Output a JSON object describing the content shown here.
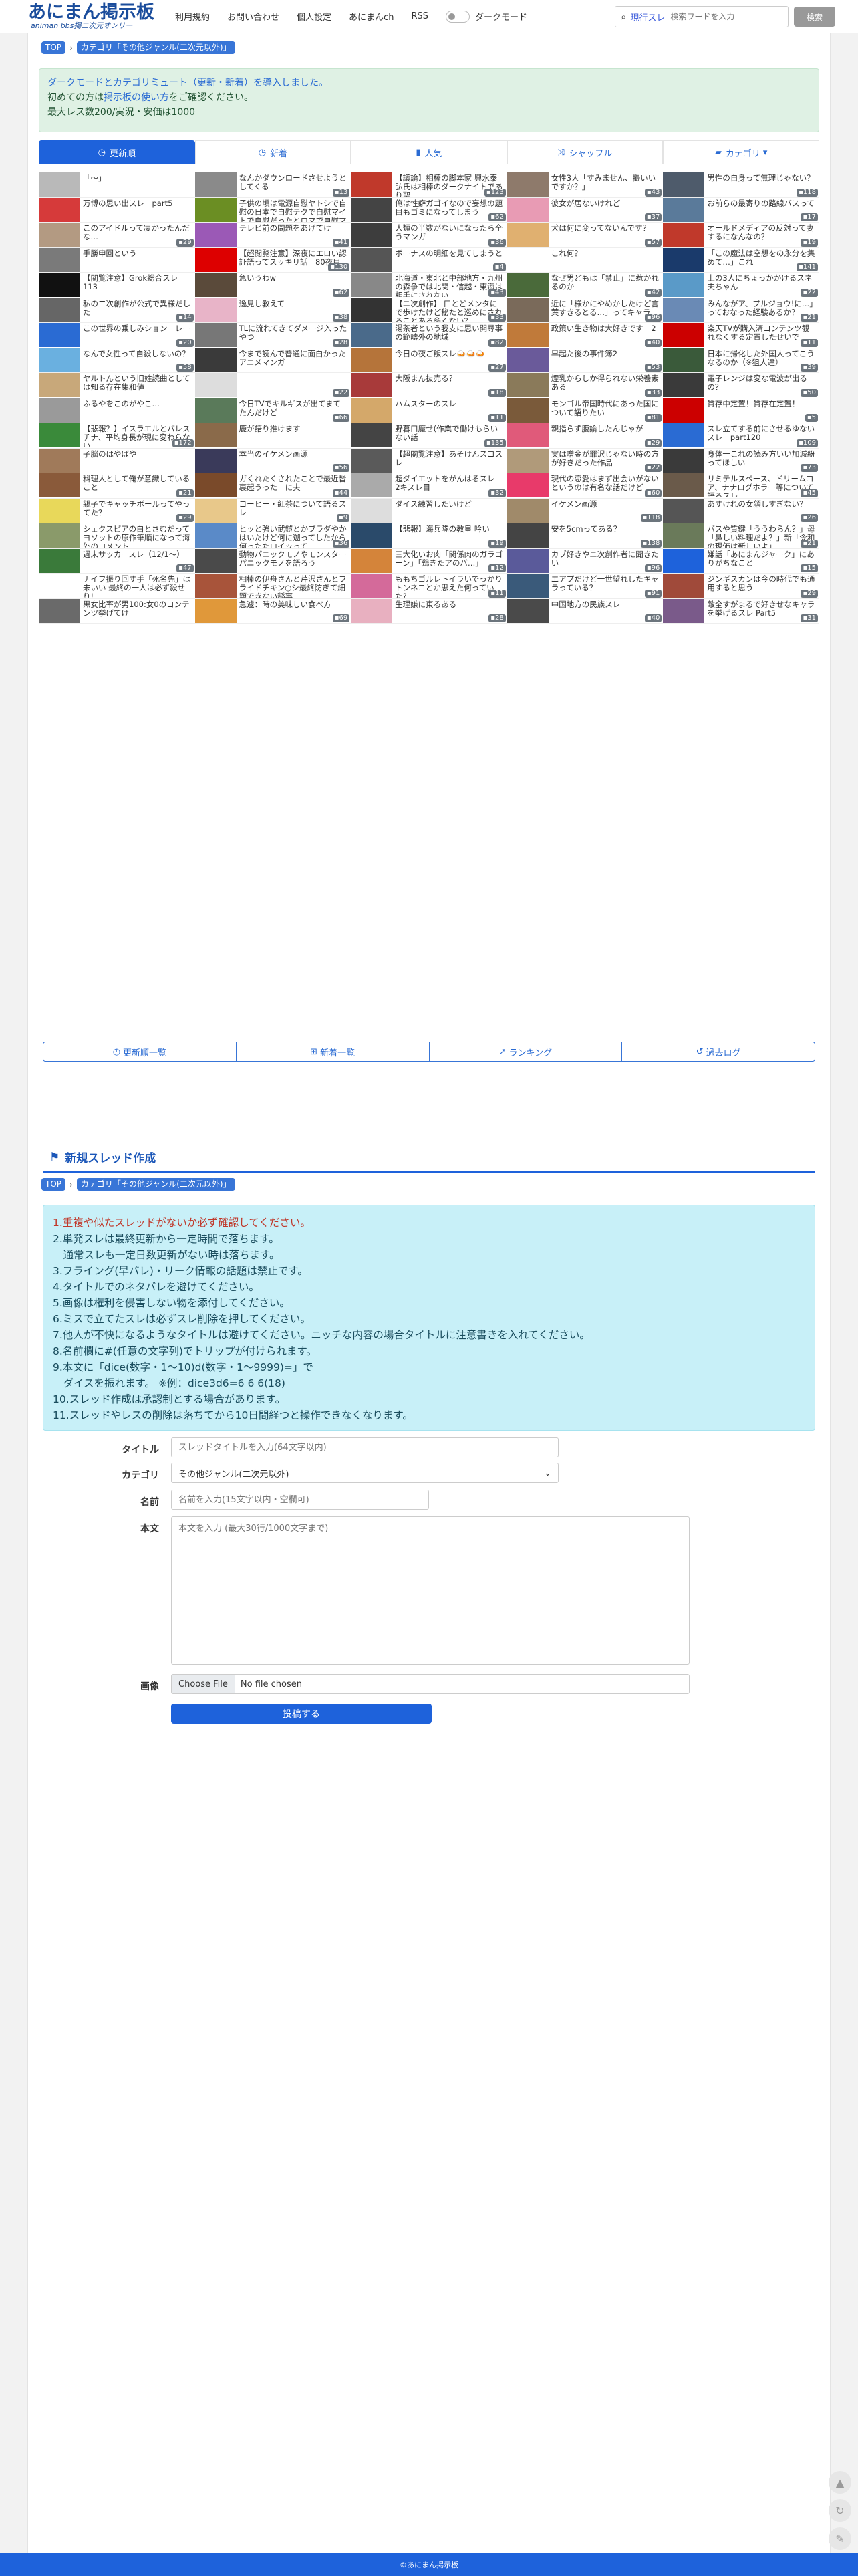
{
  "header": {
    "logo_main": "あにまん掲示板",
    "logo_sub": "animan bbs掲二次元オンリー",
    "nav": [
      "利用規約",
      "お問い合わせ",
      "個人設定",
      "あにまんch",
      "RSS"
    ],
    "dark_mode_label": "ダークモード",
    "search_scope": "現行スレ",
    "search_placeholder": "検索ワードを入力",
    "search_button": "検索"
  },
  "breadcrumb": [
    "TOP",
    "カテゴリ「その他ジャンル(二次元以外)」"
  ],
  "notice": {
    "line1": "ダークモードとカテゴリミュート（更新・新着）を導入しました。",
    "line2_pre": "初めての方は",
    "line2_link": "掲示板の使い方",
    "line2_post": "をご確認ください。",
    "line3": "最大レス数200/実況・安価は1000"
  },
  "tabs": [
    {
      "label": "更新順",
      "icon": "clock-icon"
    },
    {
      "label": "新着",
      "icon": "clock-icon"
    },
    {
      "label": "人気",
      "icon": "chart-icon"
    },
    {
      "label": "シャッフル",
      "icon": "shuffle-icon"
    },
    {
      "label": "カテゴリ",
      "icon": "folder-icon"
    }
  ],
  "threads": [
    {
      "title": "「～」",
      "count": "",
      "color": "#b9b9b9"
    },
    {
      "title": "なんかダウンロードさせようとしてくる",
      "count": "13",
      "color": "#8a8a8a"
    },
    {
      "title": "【議論】相棒の脚本家 興水泰弘氏は相棒のダークナイトであり聖…",
      "count": "123",
      "color": "#c0392b"
    },
    {
      "title": "女性3人「すみません、撮いいですか？」",
      "count": "43",
      "color": "#8e7a6b"
    },
    {
      "title": "男性の自身って無理じゃない？",
      "count": "118",
      "color": "#4e5b6b"
    },
    {
      "title": "万博の思い出スレ　part5",
      "count": "",
      "color": "#d63a3a"
    },
    {
      "title": "子供の頃は電源自慰ヤトシで自慰の日本で自慰テクで自慰マイトで自慰だったとロマで自慰マイト…",
      "count": "",
      "color": "#6b8e23"
    },
    {
      "title": "俺は性癖ガゴイなので妄想の題目もゴミになってしまう",
      "count": "62",
      "color": "#444"
    },
    {
      "title": "彼女が居ないけれど",
      "count": "37",
      "color": "#e89bb4"
    },
    {
      "title": "お前らの最寄りの路線バスって",
      "count": "17",
      "color": "#5a7a9a"
    },
    {
      "title": "このアイドルって凄かったんだな…",
      "count": "29",
      "color": "#b39a82"
    },
    {
      "title": "テレビ前の問題をあげてけ",
      "count": "41",
      "color": "#9b59b6"
    },
    {
      "title": "人類の半数がないになったら全うマンガ",
      "count": "36",
      "color": "#3d3d3d"
    },
    {
      "title": "犬は何に変ってないんです？",
      "count": "57",
      "color": "#e0b070"
    },
    {
      "title": "オールドメディアの反対って妻するになんなの？",
      "count": "19",
      "color": "#c0392b"
    },
    {
      "title": "手勝申回という",
      "count": "",
      "color": "#7a7a7a"
    },
    {
      "title": "【超閲覧注意】深夜にエロい認証語ってスッキリ話　80夜目",
      "count": "130",
      "color": "#d00"
    },
    {
      "title": "ボーナスの明細を見てしまうと",
      "count": "4",
      "color": "#555"
    },
    {
      "title": "これ何？",
      "count": "",
      "color": "#fff"
    },
    {
      "title": "「この魔法は空想をの永分を集めて…」これ",
      "count": "141",
      "color": "#1a3a6b"
    },
    {
      "title": "【閲覧注意】Grok総合スレ113",
      "count": "",
      "color": "#111"
    },
    {
      "title": "急いうわw",
      "count": "62",
      "color": "#5a4a3a"
    },
    {
      "title": "北海道・東北と中部地方・九州の森争では北関・信越・東海は相手にされない",
      "count": "43",
      "color": "#888"
    },
    {
      "title": "なぜ男どもは「禁止」に惹かれるのか",
      "count": "42",
      "color": "#4a6a3a"
    },
    {
      "title": "上の3人にちょっかかけるスネ夫ちゃん",
      "count": "22",
      "color": "#5a9ac8"
    },
    {
      "title": "私の二次創作が公式で異様だした",
      "count": "14",
      "color": "#666"
    },
    {
      "title": "逸見し教えて",
      "count": "38",
      "color": "#e8b4c8"
    },
    {
      "title": "【ニ次創作】 口とどメンタにで歩けたけど秘たと巡めにされることある多くない？",
      "count": "33",
      "color": "#333"
    },
    {
      "title": "近に「様かにやめかしたけど言葉すきるとる…」ってキャラ",
      "count": "96",
      "color": "#7a6a5a"
    },
    {
      "title": "みんながア、プルジョウ!に…」っておなった経験あるか？",
      "count": "21",
      "color": "#6a8ab5"
    },
    {
      "title": "この世界の乗しみションーレー",
      "count": "20",
      "color": "#2a6bd3"
    },
    {
      "title": "TLに流れてきてダメージ入ったやつ",
      "count": "28",
      "color": "#777"
    },
    {
      "title": "湯茶者という我支に思い開尋事の範疇外の地域",
      "count": "82",
      "color": "#4a6a8a"
    },
    {
      "title": "政策い生き物は大好きです　2",
      "count": "40",
      "color": "#c07a3a"
    },
    {
      "title": "楽天TVが購入済コンテンツ観れなくする定置したせいで",
      "count": "11",
      "color": "#c00"
    },
    {
      "title": "なんで女性って自殺しないの？",
      "count": "58",
      "color": "#6ab0e0"
    },
    {
      "title": "今まで読んで普通に面白かったアニメマンガ",
      "count": "",
      "color": "#3a3a3a"
    },
    {
      "title": "今日の夜ご飯スレ🍛🍛🍛",
      "count": "27",
      "color": "#b5743a"
    },
    {
      "title": "早起た後の事件簿2",
      "count": "53",
      "color": "#6a5a9a"
    },
    {
      "title": "日本に帰化した外国人ってこうなるのか（※狙人達）",
      "count": "39",
      "color": "#3a5a3a"
    },
    {
      "title": "ヤルトんという旧姓読曲としては知る存在集和値",
      "count": "",
      "color": "#c8a87a"
    },
    {
      "title": "",
      "count": "22",
      "color": "#ddd"
    },
    {
      "title": "大阪まん抜売る？",
      "count": "18",
      "color": "#a83a3a"
    },
    {
      "title": "煙乳からしか得られない栄養素ある",
      "count": "33",
      "color": "#8a7a5a"
    },
    {
      "title": "電子レンジは変な電波が出るの？",
      "count": "50",
      "color": "#3a3a3a"
    },
    {
      "title": "ふるやをこのがやこ…",
      "count": "",
      "color": "#9a9a9a"
    },
    {
      "title": "今日TVでキルギスが出てまてたんだけど",
      "count": "66",
      "color": "#5a7a5a"
    },
    {
      "title": "ハムスターのスレ",
      "count": "11",
      "color": "#d4a86a"
    },
    {
      "title": "モンゴル帝国時代にあった国について語りたい",
      "count": "81",
      "color": "#7a5a3a"
    },
    {
      "title": "質存中定置！質存在定置！",
      "count": "5",
      "color": "#c00"
    },
    {
      "title": "【悲報？】イスラエルとパレスチナ、平均身長が現に変わらない",
      "count": "172",
      "color": "#3a8a3a"
    },
    {
      "title": "鹿が語り推けます",
      "count": "",
      "color": "#8a6a4a"
    },
    {
      "title": "野暮口魔せ(作業で働けもらいない話",
      "count": "135",
      "color": "#444"
    },
    {
      "title": "親指らず腹論したんじゃが",
      "count": "29",
      "color": "#e05a7a"
    },
    {
      "title": "スレ立てする前にさせるゆないスレ　part120",
      "count": "109",
      "color": "#2a6bd3"
    },
    {
      "title": "子脳のはやばや",
      "count": "",
      "color": "#a07a5a"
    },
    {
      "title": "本当のイケメン画源",
      "count": "56",
      "color": "#3a3a5a"
    },
    {
      "title": "【超閲覧注意】あそけんスコスレ",
      "count": "",
      "color": "#5a5a5a"
    },
    {
      "title": "実は噌金が罪沢じゃない時の方が好きだった作品",
      "count": "22",
      "color": "#b09a7a"
    },
    {
      "title": "身体一これの読み方いい加減紛ってほしい",
      "count": "73",
      "color": "#3a3a3a"
    },
    {
      "title": "料理人として俺が意識していること",
      "count": "21",
      "color": "#8a5a3a"
    },
    {
      "title": "ガくれたくされたことで最近皆裏起うった一に夫",
      "count": "44",
      "color": "#7a4a2a"
    },
    {
      "title": "超ダイエットをがんはるスレ　2キスレ目",
      "count": "32",
      "color": "#aaa"
    },
    {
      "title": "現代の恋愛はまず出会いがないというのは有名な話だけど",
      "count": "60",
      "color": "#e83a6a"
    },
    {
      "title": "リミテルスペース、ドリームコア、ナナログホラー等について語るスレ",
      "count": "45",
      "color": "#6a5a4a"
    },
    {
      "title": "親子でキャッチボールってやってた？",
      "count": "29",
      "color": "#e8d85a"
    },
    {
      "title": "コーヒー・紅茶について語るスレ",
      "count": "9",
      "color": "#e8c88a"
    },
    {
      "title": "ダイス練習したいけど",
      "count": "",
      "color": "#ddd"
    },
    {
      "title": "イケメン画源",
      "count": "118",
      "color": "#a08a6a"
    },
    {
      "title": "あすけれの女顔しすぎない？",
      "count": "26",
      "color": "#555"
    },
    {
      "title": "シェクスピアの白とさむだってヨソットの原作筆順になって海外のコメント",
      "count": "",
      "color": "#8a9a6a"
    },
    {
      "title": "ヒッと強い武鎧とかブラダやかはいたけど何に遡ってしたから何ったたロイッって",
      "count": "36",
      "color": "#5a8ac8"
    },
    {
      "title": "【悲報】海兵隊の教皇 吟い",
      "count": "19",
      "color": "#2a4a6a"
    },
    {
      "title": "安を5cmってある？",
      "count": "138",
      "color": "#444"
    },
    {
      "title": "バスや質鍵「ううわらん？」母「鼻しい料理だよ？」新「令和の現価は新しいよ」",
      "count": "21",
      "color": "#6a7a5a"
    },
    {
      "title": "週末サッカースレ（12/1〜）",
      "count": "47",
      "color": "#3a7a3a"
    },
    {
      "title": "動物パニックモノやモンスターパニックモノを語ろう",
      "count": "",
      "color": "#4a4a4a"
    },
    {
      "title": "三大化いお肉「関係肉のガラゴーン」「鶏きたアのバ…」",
      "count": "12",
      "color": "#d4843a"
    },
    {
      "title": "カブ好きやニ次創作者に聞きたい",
      "count": "96",
      "color": "#5a5a9a"
    },
    {
      "title": "嫌話「あにまんジャーク」にありがちなこと",
      "count": "15",
      "color": "#1e62db"
    },
    {
      "title": "ナイフ振り回す手「死名先」は未いい 最終の一人は必ず殺せり!",
      "count": "",
      "color": "#fff"
    },
    {
      "title": "相棒の伊舟さんと芹沢さんとフライドチキン○シ最終防ぎて細題できない稲事",
      "count": "",
      "color": "#a8543a"
    },
    {
      "title": "ももちゴルレトイラいでっかりトンネコとか思えた何っていた?",
      "count": "11",
      "color": "#d46a9a"
    },
    {
      "title": "エアプだけど一世望れしたキャラっている？",
      "count": "91",
      "color": "#3a5a7a"
    },
    {
      "title": "ジンギスカンは今の時代でも通用すると思う",
      "count": "29",
      "color": "#a04a3a"
    },
    {
      "title": "黒女比率が男100:女0のコンテンツ挙げてけ",
      "count": "",
      "color": "#6a6a6a"
    },
    {
      "title": "急遽：時の美味しい食べ方",
      "count": "69",
      "color": "#e0983a"
    },
    {
      "title": "生理嫌に東るある",
      "count": "28",
      "color": "#e8b0c0"
    },
    {
      "title": "中国地方の民族スレ",
      "count": "40",
      "color": "#4a4a4a"
    },
    {
      "title": "敵全すがまるで好きせなキャラを挙げるスレ Part5",
      "count": "31",
      "color": "#7a5a8a"
    }
  ],
  "subnav": [
    {
      "label": "更新順一覧",
      "icon": "clock-icon"
    },
    {
      "label": "新着一覧",
      "icon": "plus-icon"
    },
    {
      "label": "ランキング",
      "icon": "chart-icon"
    },
    {
      "label": "過去ログ",
      "icon": "history-icon"
    }
  ],
  "new_thread": {
    "title": "新規スレッド作成",
    "rules": [
      "1.重複や似たスレッドがないか必ず確認してください。",
      "2.単発スレは最終更新から一定時間で落ちます。",
      "　通常スレも一定日数更新がない時は落ちます。",
      "3.フライング(早バレ)・リーク情報の話題は禁止です。",
      "4.タイトルでのネタバレを避けてください。",
      "5.画像は権利を侵害しない物を添付してください。",
      "6.ミスで立てたスレは必ずスレ削除を押してください。",
      "7.他人が不快になるようなタイトルは避けてください。ニッチな内容の場合タイトルに注意書きを入れてください。",
      "8.名前欄に#(任意の文字列)でトリップが付けられます。",
      "9.本文に「dice(数字・1〜10)d(数字・1〜9999)=」で",
      "　ダイスを振れます。 ※例：dice3d6=6 6 6(18)",
      "10.スレッド作成は承認制とする場合があります。",
      "11.スレッドやレスの削除は落ちてから10日間経つと操作できなくなります。"
    ],
    "label_title": "タイトル",
    "placeholder_title": "スレッドタイトルを入力(64文字以内)",
    "label_category": "カテゴリ",
    "category_value": "その他ジャンル(二次元以外)",
    "label_name": "名前",
    "placeholder_name": "名前を入力(15文字以内・空欄可)",
    "label_body": "本文",
    "placeholder_body": "本文を入力 (最大30行/1000文字まで)",
    "label_image": "画像",
    "file_button": "Choose File",
    "file_status": "No file chosen",
    "submit": "投稿する"
  },
  "footer": "©あにまん掲示板"
}
